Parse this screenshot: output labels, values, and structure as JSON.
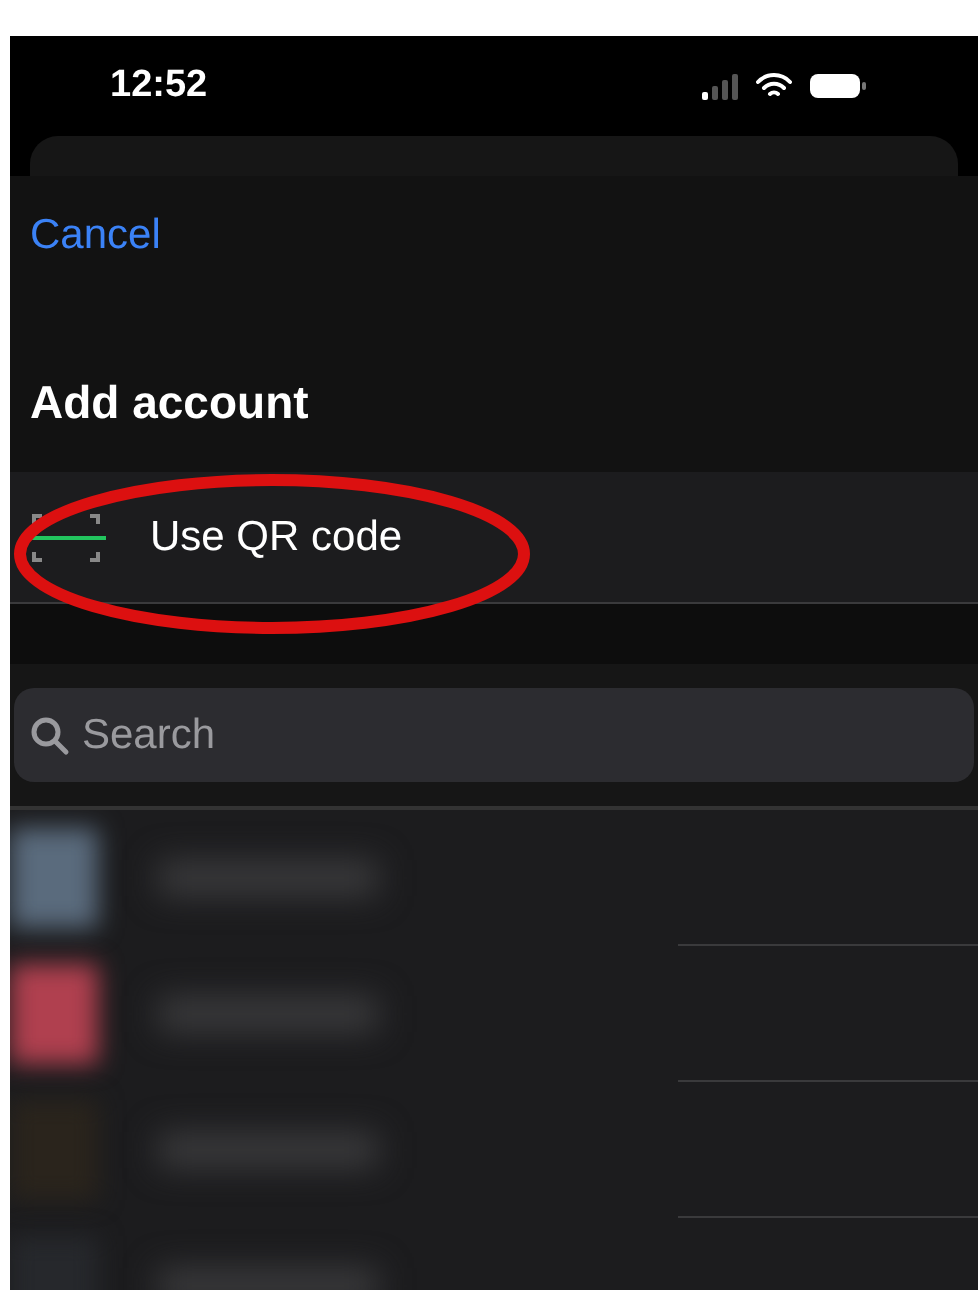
{
  "status_bar": {
    "time": "12:52"
  },
  "sheet": {
    "cancel": "Cancel",
    "title": "Add account",
    "qr_option": {
      "label": "Use QR code"
    }
  },
  "search": {
    "placeholder": "Search"
  },
  "accounts": [
    {
      "color": "#5a6b7d"
    },
    {
      "color": "#b0404f"
    },
    {
      "color": "#2a241c"
    },
    {
      "color": "#26282c"
    }
  ]
}
